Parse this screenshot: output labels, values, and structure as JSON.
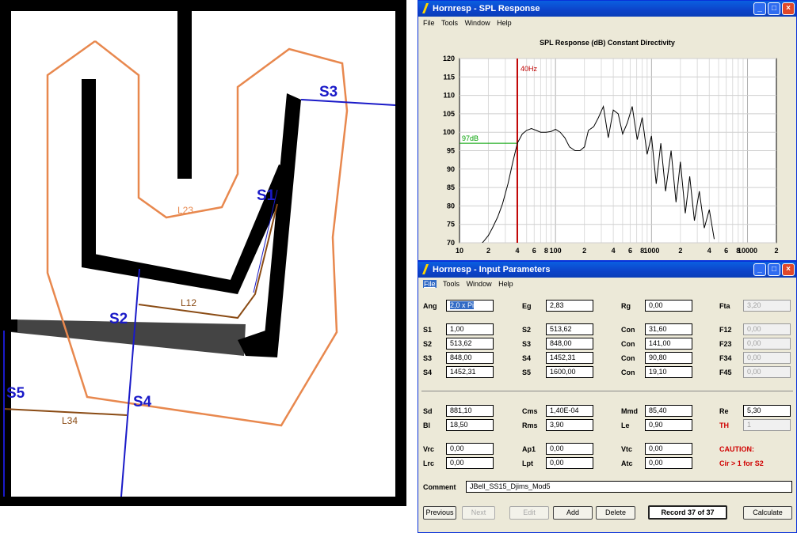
{
  "diagram": {
    "labels": {
      "s1": "S1",
      "s2": "S2",
      "s3": "S3",
      "s4": "S4",
      "s5": "S5",
      "l12": "L12",
      "l23": "L23",
      "l34": "L34"
    },
    "colors": {
      "section": "#1a1ac8",
      "path_orange": "#e8884e",
      "path_brown": "#8a4b14",
      "wall": "#000000"
    }
  },
  "spl_window": {
    "title": "Hornresp - SPL Response",
    "menu": [
      "File",
      "Tools",
      "Window",
      "Help"
    ],
    "chart_title": "SPL Response (dB)   Constant Directivity",
    "marker_freq_label": "40Hz",
    "marker_level_label": "97dB",
    "controls": {
      "minimize": "_",
      "maximize": "□",
      "close": "×"
    }
  },
  "chart_data": {
    "type": "line",
    "title": "SPL Response (dB)   Constant Directivity",
    "xscale": "log",
    "xlim": [
      10,
      20000
    ],
    "ylim": [
      70,
      120
    ],
    "yticks": [
      70,
      75,
      80,
      85,
      90,
      95,
      100,
      105,
      110,
      115,
      120
    ],
    "xtick_labels": [
      "10",
      "2",
      "4",
      "6",
      "8",
      "100",
      "2",
      "4",
      "6",
      "8",
      "1000",
      "2",
      "4",
      "6",
      "8",
      "10000",
      "2"
    ],
    "grid": true,
    "markers": {
      "frequency_hz": 40,
      "level_db": 97
    },
    "series": [
      {
        "x": [
          10,
          12,
          14,
          16,
          18,
          20,
          22,
          25,
          28,
          32,
          36,
          40,
          45,
          50,
          56,
          63,
          70,
          80,
          90,
          100,
          112,
          125,
          140,
          160,
          180,
          200,
          220,
          250,
          280,
          315,
          355,
          400,
          450,
          500,
          560,
          630,
          710,
          800,
          900,
          1000,
          1120,
          1250,
          1400,
          1600,
          1800,
          2000,
          2250,
          2500,
          2800,
          3150,
          3550,
          4000,
          4500
        ],
        "y": [
          64,
          66,
          67.5,
          69,
          70.5,
          72,
          74,
          77,
          80.5,
          86,
          92,
          97,
          99.5,
          100.5,
          101,
          100.5,
          100,
          100,
          100.2,
          100.8,
          100,
          98.5,
          96,
          95,
          95,
          96,
          100.5,
          101.5,
          104,
          107,
          98.5,
          106,
          105,
          99.5,
          102.5,
          107,
          98,
          104,
          94,
          99,
          86,
          97,
          84,
          95,
          81,
          92,
          78,
          88,
          76,
          84,
          74,
          79,
          71
        ]
      }
    ]
  },
  "input_window": {
    "title": "Hornresp - Input Parameters",
    "menu": [
      "File",
      "Tools",
      "Window",
      "Help"
    ],
    "controls": {
      "minimize": "_",
      "maximize": "□",
      "close": "×"
    },
    "row0": [
      {
        "label": "Ang",
        "value": "2,0 x Pi"
      },
      {
        "label": "Eg",
        "value": "2,83"
      },
      {
        "label": "Rg",
        "value": "0,00"
      },
      {
        "label": "Fta",
        "value": "3,20"
      }
    ],
    "grid1": [
      [
        {
          "label": "S1",
          "value": "1,00"
        },
        {
          "label": "S2",
          "value": "513,62"
        },
        {
          "label": "Con",
          "value": "31,60"
        },
        {
          "label": "F12",
          "value": "0,00"
        }
      ],
      [
        {
          "label": "S2",
          "value": "513,62"
        },
        {
          "label": "S3",
          "value": "848,00"
        },
        {
          "label": "Con",
          "value": "141,00"
        },
        {
          "label": "F23",
          "value": "0,00"
        }
      ],
      [
        {
          "label": "S3",
          "value": "848,00"
        },
        {
          "label": "S4",
          "value": "1452,31"
        },
        {
          "label": "Con",
          "value": "90,80"
        },
        {
          "label": "F34",
          "value": "0,00"
        }
      ],
      [
        {
          "label": "S4",
          "value": "1452,31"
        },
        {
          "label": "S5",
          "value": "1600,00"
        },
        {
          "label": "Con",
          "value": "19,10"
        },
        {
          "label": "F45",
          "value": "0,00"
        }
      ]
    ],
    "grid2": [
      [
        {
          "label": "Sd",
          "value": "881,10"
        },
        {
          "label": "Cms",
          "value": "1,40E-04"
        },
        {
          "label": "Mmd",
          "value": "85,40"
        },
        {
          "label": "Re",
          "value": "5,30"
        }
      ],
      [
        {
          "label": "Bl",
          "value": "18,50"
        },
        {
          "label": "Rms",
          "value": "3,90"
        },
        {
          "label": "Le",
          "value": "0,90"
        },
        {
          "label": "TH",
          "value": "1"
        }
      ]
    ],
    "grid3": [
      [
        {
          "label": "Vrc",
          "value": "0,00"
        },
        {
          "label": "Ap1",
          "value": "0,00"
        },
        {
          "label": "Vtc",
          "value": "0,00"
        }
      ],
      [
        {
          "label": "Lrc",
          "value": "0,00"
        },
        {
          "label": "Lpt",
          "value": "0,00"
        },
        {
          "label": "Atc",
          "value": "0,00"
        }
      ]
    ],
    "caution_title": "CAUTION:",
    "caution_text": "Cir > 1 for S2",
    "comment_label": "Comment",
    "comment_value": "JBell_SS15_Djims_Mod5",
    "buttons": {
      "previous": "Previous",
      "next": "Next",
      "edit": "Edit",
      "add": "Add",
      "delete": "Delete",
      "record": "Record 37 of 37",
      "calculate": "Calculate"
    }
  }
}
